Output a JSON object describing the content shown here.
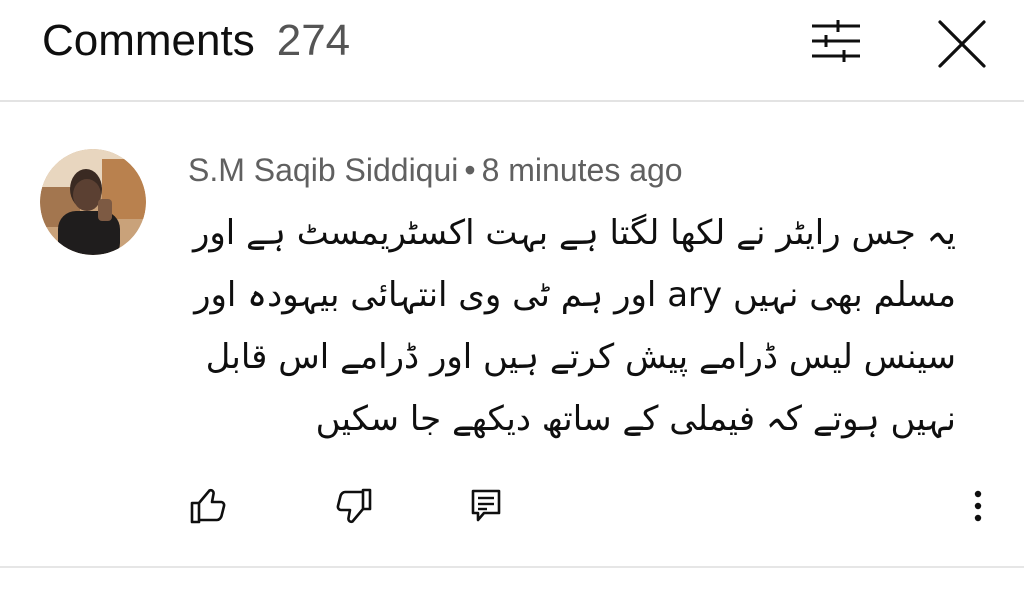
{
  "header": {
    "title": "Comments",
    "count": "274",
    "filter_icon": "sliders-icon",
    "close_icon": "close-icon"
  },
  "comment": {
    "author": "S.M Saqib Siddiqui",
    "separator": "•",
    "time": "8 minutes ago",
    "text": "یہ جس رایٹر نے لکھا لگتا ہے بہت اکسٹریمسٹ ہے اور مسلم بھی نہیں ary اور ہم ٹی وی انتہائی بیہودہ اور سینس لیس ڈرامے پیش کرتے ہیں اور ڈرامے اس قابل نہیں ہوتے کہ فیملی کے ساتھ دیکھے جا سکیں",
    "actions": {
      "like_icon": "thumbs-up-icon",
      "dislike_icon": "thumbs-down-icon",
      "reply_icon": "reply-comment-icon",
      "more_icon": "more-vertical-icon"
    }
  },
  "colors": {
    "text": "#0f0f0f",
    "secondary": "#606060",
    "divider": "#e3e3e3"
  }
}
